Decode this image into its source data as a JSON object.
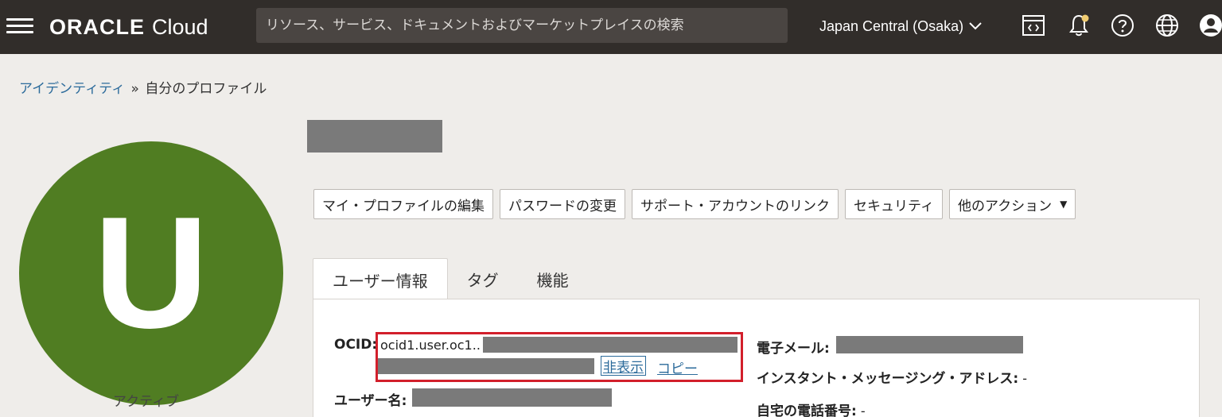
{
  "header": {
    "logo_brand": "ORACLE",
    "logo_product": "Cloud",
    "search_placeholder": "リソース、サービス、ドキュメントおよびマーケットプレイスの検索",
    "region": "Japan Central (Osaka)",
    "icons": [
      "menu-icon",
      "code-editor-icon",
      "notification-bell-icon",
      "help-icon",
      "language-globe-icon",
      "user-profile-icon"
    ],
    "colors": {
      "bar": "#312d2a",
      "search_bg": "#4a4542",
      "notification_dot": "#f0cc71"
    }
  },
  "breadcrumb": {
    "parent": "アイデンティティ",
    "separator": "»",
    "current": "自分のプロファイル"
  },
  "avatar": {
    "letter": "U",
    "color": "#507d22",
    "status": "アクティブ"
  },
  "actions": {
    "edit_profile": "マイ・プロファイルの編集",
    "change_password": "パスワードの変更",
    "link_support_account": "サポート・アカウントのリンク",
    "security": "セキュリティ",
    "more_actions": "他のアクション"
  },
  "tabs": {
    "user_info": "ユーザー情報",
    "tags": "タグ",
    "capabilities": "機能"
  },
  "user_info": {
    "ocid_label": "OCID:",
    "ocid_value": "ocid1.user.oc1..",
    "hide_link": "非表示",
    "copy_link": "コピー",
    "username_label": "ユーザー名:",
    "email_label": "電子メール:",
    "im_address_label": "インスタント・メッセージング・アドレス:",
    "im_address_value": "-",
    "home_phone_label": "自宅の電話番号:",
    "home_phone_value": "-"
  },
  "highlight_color": "#d21f2b"
}
